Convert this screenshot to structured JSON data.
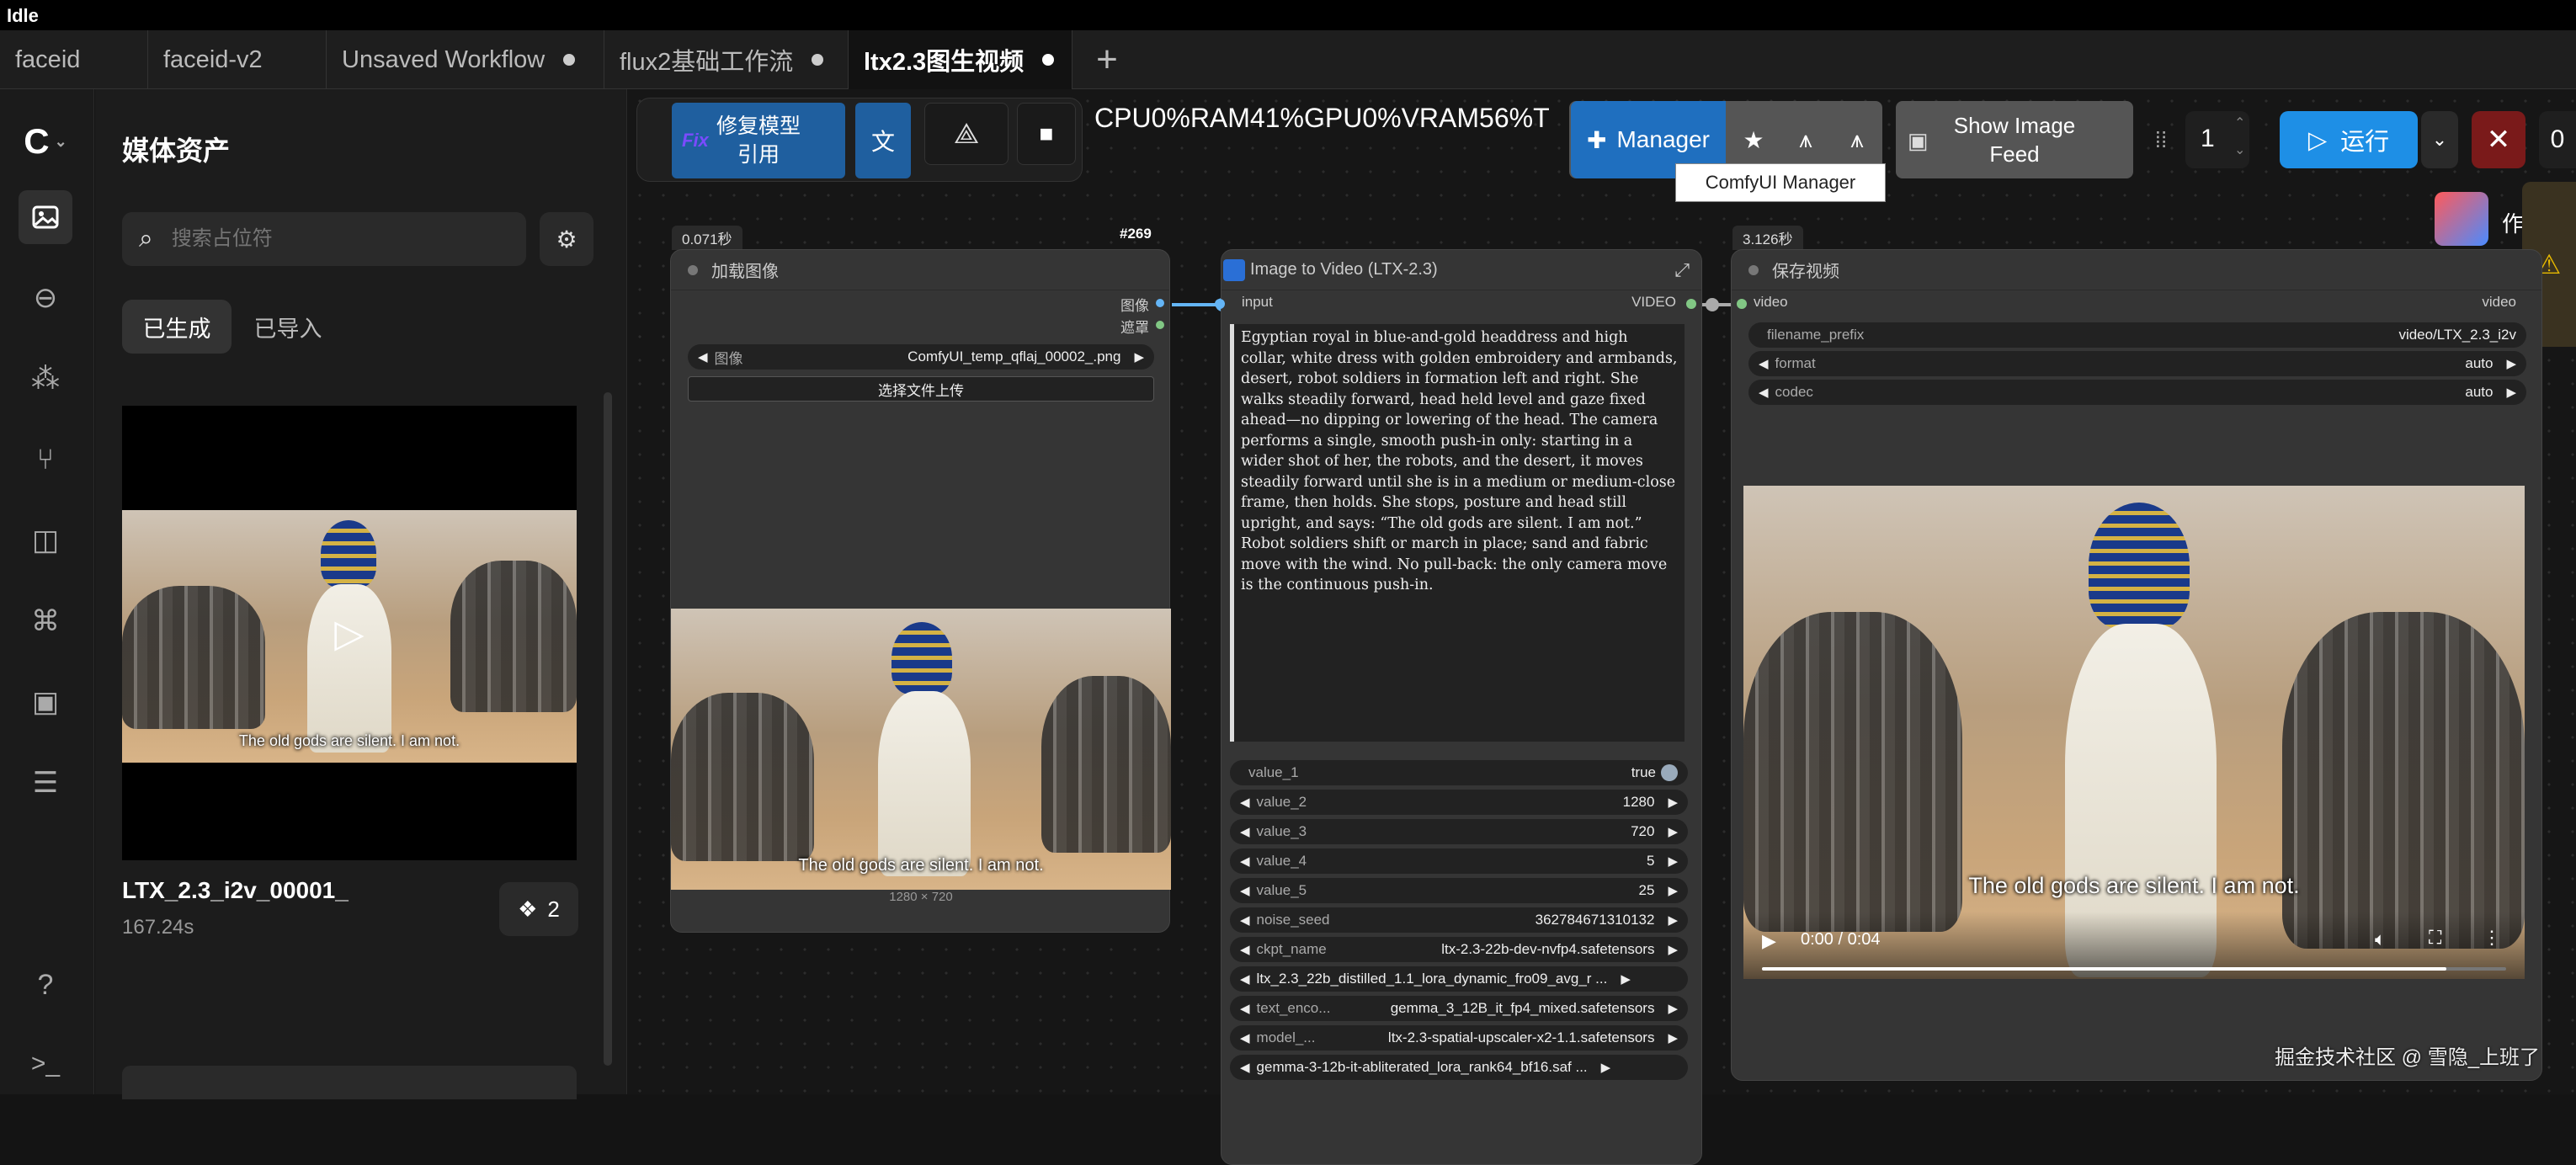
{
  "window": {
    "title": "Idle"
  },
  "tabs": [
    {
      "label": "faceid",
      "dirty": false
    },
    {
      "label": "faceid-v2",
      "dirty": false
    },
    {
      "label": "Unsaved Workflow",
      "dirty": true
    },
    {
      "label": "flux2基础工作流",
      "dirty": true
    },
    {
      "label": "ltx2.3图生视频",
      "dirty": true,
      "active": true
    }
  ],
  "sidebar": {
    "title": "媒体资产",
    "search_placeholder": "搜索占位符",
    "filter_tabs": [
      "已生成",
      "已导入"
    ],
    "active_filter": "已生成",
    "asset": {
      "name": "LTX_2.3_i2v_00001_",
      "duration": "167.24s",
      "stack_count": "2",
      "caption": "The old gods are silent. I am not."
    }
  },
  "toolbar": {
    "fix_model_label": "修复模型\n引用",
    "fix_model_line1": "修复模型",
    "fix_model_line2": "引用",
    "stats": "CPU0%RAM41%GPU0%VRAM56%T",
    "manager_label": "Manager",
    "manager_tooltip": "ComfyUI Manager",
    "show_feed_line1": "Show Image",
    "show_feed_line2": "Feed",
    "batch_count": "1",
    "run_label": "运行",
    "queue_count": "0"
  },
  "nodes": {
    "load_image": {
      "time": "0.071秒",
      "title": "加载图像",
      "out_image": "图像",
      "out_mask": "遮罩",
      "image_label": "图像",
      "image_value": "ComfyUI_temp_qflaj_00002_.png",
      "upload_label": "选择文件上传",
      "caption": "The old gods are silent. I am not.",
      "size": "1280 × 720"
    },
    "i2v": {
      "id": "#269",
      "title": "Image to Video (LTX-2.3)",
      "input": "input",
      "output": "VIDEO",
      "prompt": "Egyptian royal in blue-and-gold headdress and high collar, white dress with golden embroidery and armbands, desert, robot soldiers in formation left and right. She walks steadily forward, head held level and gaze fixed ahead—no dipping or lowering of the head. The camera performs a single, smooth push-in only: starting in a wider shot of her, the robots, and the desert, it moves steadily forward until she is in a medium or medium-close frame, then holds. She stops, posture and head still upright, and says: “The old gods are silent. I am not.” Robot soldiers shift or march in place; sand and fabric move with the wind. No pull-back: the only camera move is the continuous push-in.",
      "widgets": [
        {
          "label": "value_1",
          "value": "true"
        },
        {
          "label": "value_2",
          "value": "1280"
        },
        {
          "label": "value_3",
          "value": "720"
        },
        {
          "label": "value_4",
          "value": "5"
        },
        {
          "label": "value_5",
          "value": "25"
        },
        {
          "label": "noise_seed",
          "value": "362784671310132"
        },
        {
          "label": "ckpt_name",
          "value": "ltx-2.3-22b-dev-nvfp4.safetensors"
        },
        {
          "label": "",
          "value": "ltx_2.3_22b_distilled_1.1_lora_dynamic_fro09_avg_r ..."
        },
        {
          "label": "text_enco...",
          "value": "gemma_3_12B_it_fp4_mixed.safetensors"
        },
        {
          "label": "model_...",
          "value": "ltx-2.3-spatial-upscaler-x2-1.1.safetensors"
        },
        {
          "label": "",
          "value": "gemma-3-12b-it-abliterated_lora_rank64_bf16.saf ..."
        }
      ]
    },
    "save_video": {
      "time": "3.126秒",
      "title": "保存视频",
      "input": "video",
      "output": "video",
      "widgets": [
        {
          "label": "filename_prefix",
          "value": "video/LTX_2.3_i2v"
        },
        {
          "label": "format",
          "value": "auto"
        },
        {
          "label": "codec",
          "value": "auto"
        }
      ],
      "caption": "The old gods are silent. I am not.",
      "player_time": "0:00 / 0:04",
      "progress": 0.92
    }
  },
  "watermark": "掘金技术社区 @ 雪隐_上班了",
  "side_peek": "作",
  "icons": [
    "comfy-logo-icon",
    "assets-icon",
    "nodes-icon",
    "models-icon",
    "workflows-icon",
    "templates-icon",
    "graph-icon",
    "gallery-icon",
    "layout-icon",
    "help-icon",
    "terminal-icon"
  ]
}
